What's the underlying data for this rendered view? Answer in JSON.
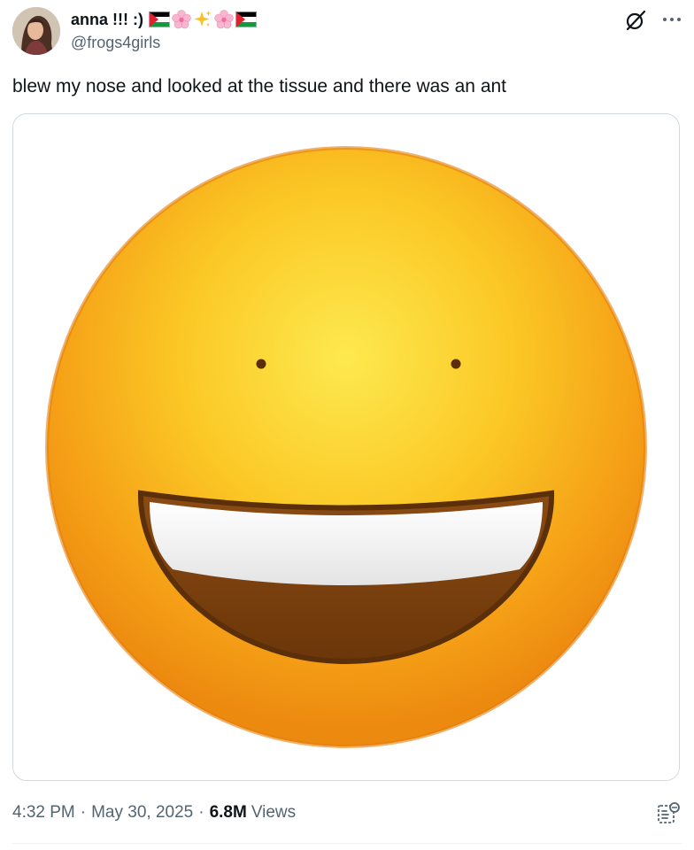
{
  "author": {
    "display_name": "anna !!! :)",
    "handle": "@frogs4girls"
  },
  "name_emojis": [
    "palestine-flag",
    "cherry-blossom",
    "sparkles",
    "cherry-blossom",
    "palestine-flag"
  ],
  "tweet": {
    "text": "blew my nose and looked at the tissue and there was an ant"
  },
  "media": {
    "image": "grinning-face-with-big-eyes-emoji"
  },
  "meta": {
    "time": "4:32 PM",
    "separator": "·",
    "date": "May 30, 2025",
    "views_count": "6.8M",
    "views_label": "Views"
  },
  "colors": {
    "text": "#0f1419",
    "secondary": "#536471",
    "border": "#cfd9de",
    "emoji_face": "#f6b21b"
  },
  "icons": {
    "grok": "grok-icon",
    "more": "more-icon",
    "analytics": "analytics-icon"
  }
}
